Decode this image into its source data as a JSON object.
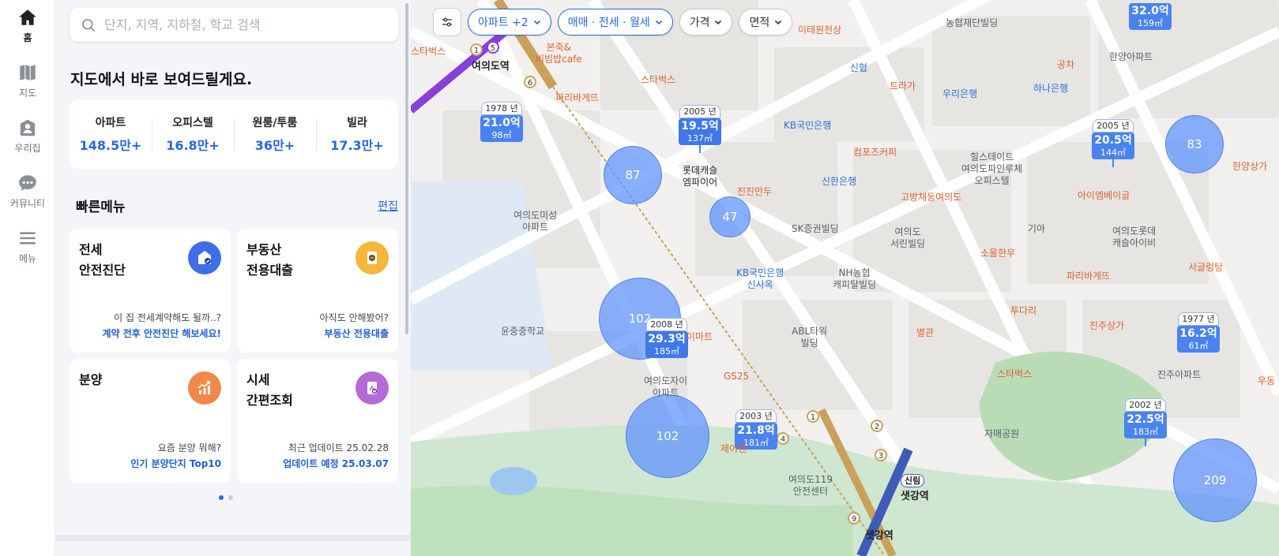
{
  "nav": [
    {
      "label": "홈",
      "icon": "home-icon",
      "active": true
    },
    {
      "label": "지도",
      "icon": "map-icon",
      "active": false
    },
    {
      "label": "우리집",
      "icon": "my-home-icon",
      "active": false
    },
    {
      "label": "커뮤니티",
      "icon": "community-icon",
      "active": false
    },
    {
      "label": "메뉴",
      "icon": "menu-icon",
      "active": false
    }
  ],
  "search": {
    "placeholder": "단지, 지역, 지하철, 학교 검색"
  },
  "headline": "지도에서 바로 보여드릴게요.",
  "stats": [
    {
      "label": "아파트",
      "value": "148.5만+"
    },
    {
      "label": "오피스텔",
      "value": "16.8만+"
    },
    {
      "label": "원룸/투룸",
      "value": "36만+"
    },
    {
      "label": "빌라",
      "value": "17.3만+"
    }
  ],
  "quick_menu": {
    "title": "빠른메뉴",
    "edit": "편집",
    "cards": [
      {
        "title": "전세\n안전진단",
        "desc": "이 집 전세계약해도 될까..?",
        "link": "계약 전후 안전진단 해보세요!",
        "color": "#3d6ee8",
        "icon": "shield-home-icon"
      },
      {
        "title": "부동산\n전용대출",
        "desc": "아직도 안해봤어?",
        "link": "부동산 전용대출",
        "color": "#f5b73b",
        "icon": "loan-icon"
      },
      {
        "title": "분양",
        "desc": "요즘 분양 뭐해?",
        "link": "인기 분양단지 Top10",
        "color": "#f08a4b",
        "icon": "trend-chart-icon"
      },
      {
        "title": "시세\n간편조회",
        "desc": "최근 업데이트 25.02.28",
        "link": "업데이트 예정 25.03.07",
        "color": "#b66ad8",
        "icon": "price-search-icon"
      }
    ]
  },
  "filters": {
    "property": "아파트 +2",
    "deal": "매매 · 전세 · 월세",
    "price": "가격",
    "area": "면적"
  },
  "clusters": [
    "87",
    "47",
    "102",
    "102",
    "83",
    "209"
  ],
  "pins": [
    {
      "year": "1978 년",
      "price": "21.0억",
      "area": "98㎡"
    },
    {
      "year": "2005 년",
      "price": "19.5억",
      "area": "137㎡"
    },
    {
      "year": "2005 년",
      "price": "20.5억",
      "area": "144㎡"
    },
    {
      "year": "2008 년",
      "price": "29.3억",
      "area": "185㎡"
    },
    {
      "year": "2003 년",
      "price": "21.8억",
      "area": "181㎡"
    },
    {
      "year": "1977 년",
      "price": "16.2억",
      "area": "61㎡"
    },
    {
      "year": "2002 년",
      "price": "22.5억",
      "area": "183㎡"
    },
    {
      "year": "",
      "price": "32.0억",
      "area": "159㎡"
    }
  ],
  "pois": [
    "여의도역",
    "본죽&\n비빔밥cafe",
    "스타벅스",
    "파리바게뜨",
    "스타벅스",
    "이태원천상",
    "농협재단빌딩",
    "신협",
    "트라가",
    "우리은행",
    "하나은행",
    "공차",
    "한양아파트",
    "롯데캐슬\n엠파이어",
    "진진만두",
    "KB국민은행",
    "신한은행",
    "컴포즈커피",
    "힐스테이트\n여의도파인루체\n오피스텔",
    "고방채동여의도",
    "아이엠베이글",
    "한양상가",
    "여의도미성\n아파트",
    "SK증권빌딩",
    "여의도\n서린빌딩",
    "기아",
    "여의도롯데\n캐슬아이비",
    "서글렁탕",
    "KB국민은행\n신사옥",
    "NH농협\n캐피탈빌딩",
    "소울한우",
    "파리바게뜨",
    "윤중중학교",
    "이마트",
    "GS25",
    "ABL타워\n빌딩",
    "별관",
    "투다리",
    "진주상가",
    "진주아파트",
    "여의도자이\n아파트",
    "스타벅스",
    "자매공원",
    "여의도119\n안전센터",
    "제이렌",
    "샛강역",
    "신림",
    "샛강역",
    "우동"
  ]
}
